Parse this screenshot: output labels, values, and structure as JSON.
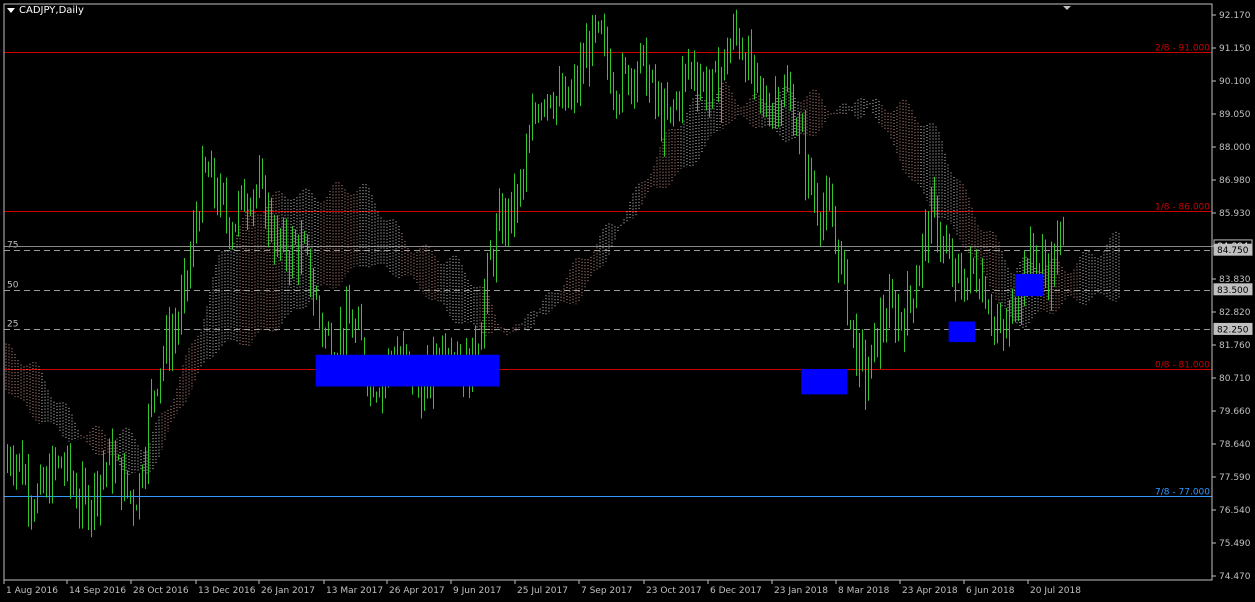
{
  "window": {
    "symbol_title": "CADJPY,Daily"
  },
  "colors": {
    "background": "#000000",
    "candle": "#31c62a",
    "cloud_a": "#ffb6a8",
    "cloud_b": "#ffffff",
    "murrey_red": "#cc0000",
    "murrey_blue": "#3399ff",
    "zone": "#0000ff",
    "axis": "#c0c0c0",
    "dashed_level": "#9a9a9a",
    "label_box": "#c0c0c0"
  },
  "price_axis": {
    "ticks": [
      "92.170",
      "91.150",
      "90.100",
      "89.050",
      "88.000",
      "86.980",
      "85.930",
      "84.884",
      "83.830",
      "82.820",
      "81.760",
      "80.710",
      "79.660",
      "78.640",
      "77.590",
      "76.540",
      "75.490",
      "74.470"
    ]
  },
  "time_axis": {
    "ticks": [
      "1 Aug 2016",
      "14 Sep 2016",
      "28 Oct 2016",
      "13 Dec 2016",
      "26 Jan 2017",
      "13 Mar 2017",
      "26 Apr 2017",
      "9 Jun 2017",
      "25 Jul 2017",
      "7 Sep 2017",
      "23 Oct 2017",
      "6 Dec 2017",
      "23 Jan 2018",
      "8 Mar 2018",
      "23 Apr 2018",
      "6 Jun 2018",
      "20 Jul 2018"
    ]
  },
  "murrey_levels": [
    {
      "label": "2/8 - 91.000",
      "price": 91.0,
      "color": "#cc0000"
    },
    {
      "label": "1/8 - 86.000",
      "price": 86.0,
      "color": "#cc0000"
    },
    {
      "label": "0/8 - 81.000",
      "price": 81.0,
      "color": "#cc0000"
    },
    {
      "label": "7/8 - 77.000",
      "price": 77.0,
      "color": "#3399ff"
    }
  ],
  "dashed_levels": [
    {
      "left_label": "75",
      "box_label": "84.750",
      "price": 84.75
    },
    {
      "left_label": "50",
      "box_label": "83.500",
      "price": 83.5
    },
    {
      "left_label": "25",
      "box_label": "82.250",
      "price": 82.25
    }
  ],
  "current_price_label": "84.884",
  "zones": [
    {
      "t0": 0.258,
      "t1": 0.41,
      "p0": 80.45,
      "p1": 81.45
    },
    {
      "t0": 0.66,
      "t1": 0.698,
      "p0": 80.2,
      "p1": 81.0
    },
    {
      "t0": 0.782,
      "t1": 0.804,
      "p0": 81.85,
      "p1": 82.5
    },
    {
      "t0": 0.837,
      "t1": 0.86,
      "p0": 83.3,
      "p1": 84.0
    }
  ],
  "chart_data": {
    "type": "candlestick",
    "symbol": "CADJPY",
    "timeframe": "Daily",
    "ylim": [
      74.47,
      92.17
    ],
    "x": [
      "1 Aug 2016",
      "14 Sep 2016",
      "28 Oct 2016",
      "13 Dec 2016",
      "26 Jan 2017",
      "13 Mar 2017",
      "26 Apr 2017",
      "9 Jun 2017",
      "25 Jul 2017",
      "7 Sep 2017",
      "23 Oct 2017",
      "6 Dec 2017",
      "23 Jan 2018",
      "8 Mar 2018",
      "23 Apr 2018",
      "6 Jun 2018",
      "20 Jul 2018"
    ],
    "close": [
      77.8,
      77.3,
      77.6,
      86.5,
      86.0,
      82.0,
      80.8,
      81.5,
      88.9,
      91.0,
      89.3,
      91.0,
      88.5,
      80.9,
      85.3,
      82.5,
      85.5
    ],
    "cloud_top": [
      81.5,
      79.6,
      78.2,
      84.5,
      86.9,
      86.3,
      84.7,
      82.3,
      84.0,
      87.7,
      90.0,
      89.3,
      89.5,
      88.3,
      83.8,
      84.8,
      84.9
    ],
    "cloud_bottom": [
      80.6,
      78.5,
      77.8,
      81.8,
      82.5,
      84.6,
      83.0,
      82.0,
      83.5,
      86.5,
      88.7,
      88.4,
      89.3,
      85.7,
      82.6,
      83.0,
      84.0
    ]
  }
}
